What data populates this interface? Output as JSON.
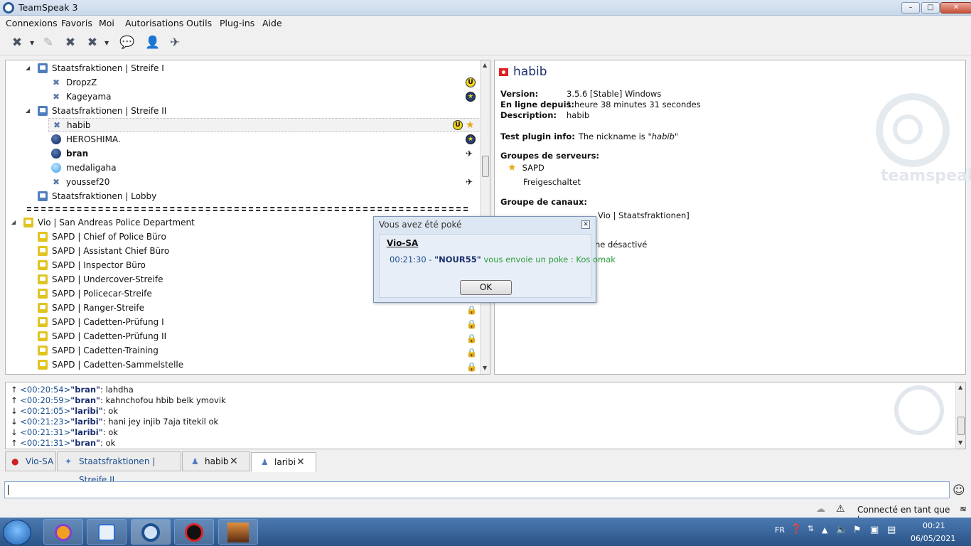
{
  "window": {
    "title": "TeamSpeak 3",
    "min": "–",
    "max": "□",
    "close": "✕"
  },
  "menu": [
    "Connexions",
    "Favoris",
    "Moi",
    "Autorisations",
    "Outils",
    "Plug-ins",
    "Aide"
  ],
  "tree": {
    "streife1": "Staatsfraktionen | Streife I",
    "dropzz": "DropzZ",
    "kageyama": "Kageyama",
    "streife2": "Staatsfraktionen | Streife II",
    "habib": "habib",
    "heroshima": "HEROSHIMA.",
    "bran": "bran",
    "medaligaha": "medaligaha",
    "youssef": "youssef20",
    "lobby": "Staatsfraktionen | Lobby",
    "separator": "=-=-=-=-=-=-=-=-=-=-=-=-=-=-=-=-=-=-=-=-=-=-=",
    "sapd_root": "Vio | San Andreas Police Department",
    "sapd_channels": [
      "SAPD | Chief of Police Büro",
      "SAPD | Assistant Chief Büro",
      "SAPD | Inspector Büro",
      "SAPD | Undercover-Streife",
      "SAPD | Policecar-Streife",
      "SAPD | Ranger-Streife",
      "SAPD | Cadetten-Prüfung I",
      "SAPD | Cadetten-Prüfung II",
      "SAPD | Cadetten-Training",
      "SAPD | Cadetten-Sammelstelle"
    ]
  },
  "info": {
    "name": "habib",
    "version_label": "Version:",
    "version": "3.5.6 [Stable] Windows",
    "online_label": "En ligne depuis:",
    "online": "1 heure 38 minutes 31 secondes",
    "desc_label": "Description:",
    "desc": "habib",
    "plugin_label": "Test plugin info:",
    "plugin_text": "The nickname is",
    "plugin_name": "\"habib\"",
    "server_groups_label": "Groupes de serveurs:",
    "group1": "SAPD",
    "group2": "Freigeschaltet",
    "channel_group_label": "Groupe de canaux:",
    "channel_group": "Vio | Staatsfraktionen]",
    "mic": "ne désactivé",
    "logo_word": "teamspeak"
  },
  "chat": [
    {
      "dir": "↑",
      "time": "<00:20:54>",
      "name": "\"bran\"",
      "msg": ": lahdha"
    },
    {
      "dir": "↑",
      "time": "<00:20:59>",
      "name": "\"bran\"",
      "msg": ": kahnchofou hbib belk ymovik"
    },
    {
      "dir": "↓",
      "time": "<00:21:05>",
      "name": "\"laribi\"",
      "msg": ": ok"
    },
    {
      "dir": "↓",
      "time": "<00:21:23>",
      "name": "\"laribi\"",
      "msg": ": hani jey injib 7aja titekil ok"
    },
    {
      "dir": "↓",
      "time": "<00:21:31>",
      "name": "\"laribi\"",
      "msg": ": ok"
    },
    {
      "dir": "↑",
      "time": "<00:21:31>",
      "name": "\"bran\"",
      "msg": ": ok"
    }
  ],
  "tabs": [
    "Vio-SA",
    "Staatsfraktionen | Streife II",
    "habib",
    "laribi"
  ],
  "status": {
    "text": "Connecté en tant que bran"
  },
  "dialog": {
    "title": "Vous avez été poké",
    "server": "Vio-SA",
    "time": "00:21:30 -",
    "who": "\"NOUR55\"",
    "msg": "vous envoie un poke : Kos omak",
    "ok": "OK"
  },
  "taskbar": {
    "lang": "FR",
    "clock": "00:21",
    "date": "06/05/2021"
  },
  "colors": {
    "accent": "#1a2f6e",
    "poke_green": "#2a9d3a",
    "timestamp": "#1a4d8f"
  }
}
